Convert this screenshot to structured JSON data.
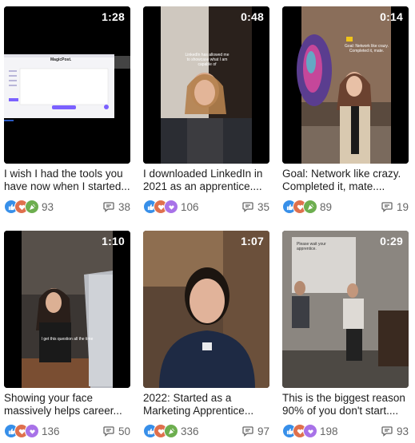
{
  "videos": [
    {
      "duration": "1:28",
      "title": "I wish I had the tools you have now when I started...",
      "reactions": [
        "like",
        "love",
        "celebrate"
      ],
      "reaction_count": "93",
      "comment_count": "38",
      "overlay_text": "MagicPost."
    },
    {
      "duration": "0:48",
      "title": "I downloaded LinkedIn in 2021 as an apprentice....",
      "reactions": [
        "like",
        "love",
        "support"
      ],
      "reaction_count": "106",
      "comment_count": "35",
      "overlay_text": "LinkedIn has allowed me to showcase what I am capable of"
    },
    {
      "duration": "0:14",
      "title": "Goal: Network like crazy. Completed it, mate....",
      "reactions": [
        "like",
        "love",
        "celebrate"
      ],
      "reaction_count": "89",
      "comment_count": "19",
      "overlay_text": "Goal: Network like crazy. Completed it, mate."
    },
    {
      "duration": "1:10",
      "title": "Showing your face massively helps career...",
      "reactions": [
        "like",
        "love",
        "support"
      ],
      "reaction_count": "136",
      "comment_count": "50",
      "overlay_text": "I get this question all the time"
    },
    {
      "duration": "1:07",
      "title": "2022: Started as a Marketing Apprentice...",
      "reactions": [
        "like",
        "love",
        "celebrate"
      ],
      "reaction_count": "336",
      "comment_count": "97",
      "overlay_text": ""
    },
    {
      "duration": "0:29",
      "title": "This is the biggest reason 90% of you don't start....",
      "reactions": [
        "like",
        "love",
        "support"
      ],
      "reaction_count": "198",
      "comment_count": "93",
      "overlay_text": "Please wait your apprentice."
    }
  ],
  "colors": {
    "like": "#378fe9",
    "love": "#df704d",
    "celebrate": "#6dae4f",
    "support": "#a872e8",
    "meta_text": "#666666"
  }
}
